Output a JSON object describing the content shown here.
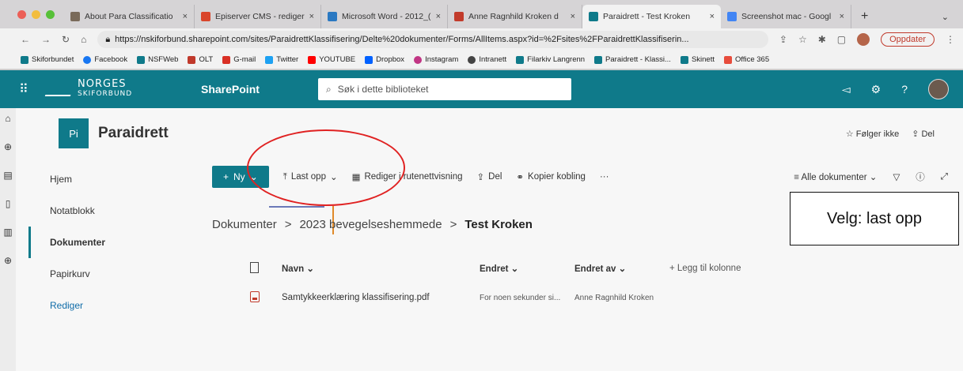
{
  "browser": {
    "tabs": [
      {
        "label": "About Para Classificatio",
        "active": false,
        "favicon_color": "#7a6a5a"
      },
      {
        "label": "Episerver CMS - rediger",
        "active": false,
        "favicon_color": "#d9452b"
      },
      {
        "label": "Microsoft Word - 2012_(",
        "active": false,
        "favicon_color": "#2b79c2"
      },
      {
        "label": "Anne Ragnhild Kroken d",
        "active": false,
        "favicon_color": "#c23b2b"
      },
      {
        "label": "Paraidrett - Test Kroken",
        "active": true,
        "favicon_color": "#0f7a8a"
      },
      {
        "label": "Screenshot mac - Googl",
        "active": false,
        "favicon_color": "#4285f4"
      }
    ],
    "new_tab": "+",
    "url": "https://nskiforbund.sharepoint.com/sites/ParaidrettKlassifisering/Delte%20dokumenter/Forms/AllItems.aspx?id=%2Fsites%2FParaidrettKlassifiserin...",
    "update_button": "Oppdater",
    "bookmarks": [
      {
        "label": "Skiforbundet",
        "icon_color": "#0f7a8a"
      },
      {
        "label": "Facebook",
        "icon_color": "#1877f2"
      },
      {
        "label": "NSFWeb",
        "icon_color": "#0f7a8a"
      },
      {
        "label": "OLT",
        "icon_color": "#c0392b"
      },
      {
        "label": "G-mail",
        "icon_color": "#d93025"
      },
      {
        "label": "Twitter",
        "icon_color": "#1da1f2"
      },
      {
        "label": "YOUTUBE",
        "icon_color": "#ff0000"
      },
      {
        "label": "Dropbox",
        "icon_color": "#0061ff"
      },
      {
        "label": "Instagram",
        "icon_color": "#c13584"
      },
      {
        "label": "Intranett",
        "icon_color": "#444444"
      },
      {
        "label": "Filarkiv Langrenn",
        "icon_color": "#0f7a8a"
      },
      {
        "label": "Paraidrett - Klassi...",
        "icon_color": "#0f7a8a"
      },
      {
        "label": "Skinett",
        "icon_color": "#0f7a8a"
      },
      {
        "label": "Office 365",
        "icon_color": "#e74c3c"
      }
    ]
  },
  "suitebar": {
    "logo_line1": "NORGES",
    "logo_line2": "SKIFORBUND",
    "app_title": "SharePoint",
    "search_placeholder": "Søk i dette biblioteket",
    "accent_color": "#0f7a8a"
  },
  "site": {
    "icon_text": "Pi",
    "name": "Paraidrett",
    "follow_label": "Følger ikke",
    "share_label": "Del"
  },
  "leftnav": {
    "items": [
      {
        "label": "Hjem"
      },
      {
        "label": "Notatblokk"
      },
      {
        "label": "Dokumenter",
        "selected": true
      },
      {
        "label": "Papirkurv"
      },
      {
        "label": "Rediger",
        "link": true
      }
    ]
  },
  "commandbar": {
    "new_label": "Ny",
    "upload_label": "Last opp",
    "grid_edit_label": "Rediger i rutenettvisning",
    "share_label": "Del",
    "copy_link_label": "Kopier kobling",
    "more_label": "···",
    "view_label": "Alle dokumenter"
  },
  "breadcrumb": {
    "items": [
      "Dokumenter",
      "2023 bevegelseshemmede"
    ],
    "current": "Test Kroken",
    "separator": ">"
  },
  "list": {
    "headers": {
      "name": "Navn",
      "modified": "Endret",
      "modified_by": "Endret av",
      "add_column": "+ Legg til kolonne"
    },
    "rows": [
      {
        "name": "Samtykkeerklæring klassifisering.pdf",
        "modified": "For noen sekunder si...",
        "modified_by": "Anne Ragnhild Kroken",
        "type_icon": "pdf-icon"
      }
    ]
  },
  "annotation": {
    "callout_text": "Velg: last opp",
    "highlight_color": "#e02222"
  }
}
